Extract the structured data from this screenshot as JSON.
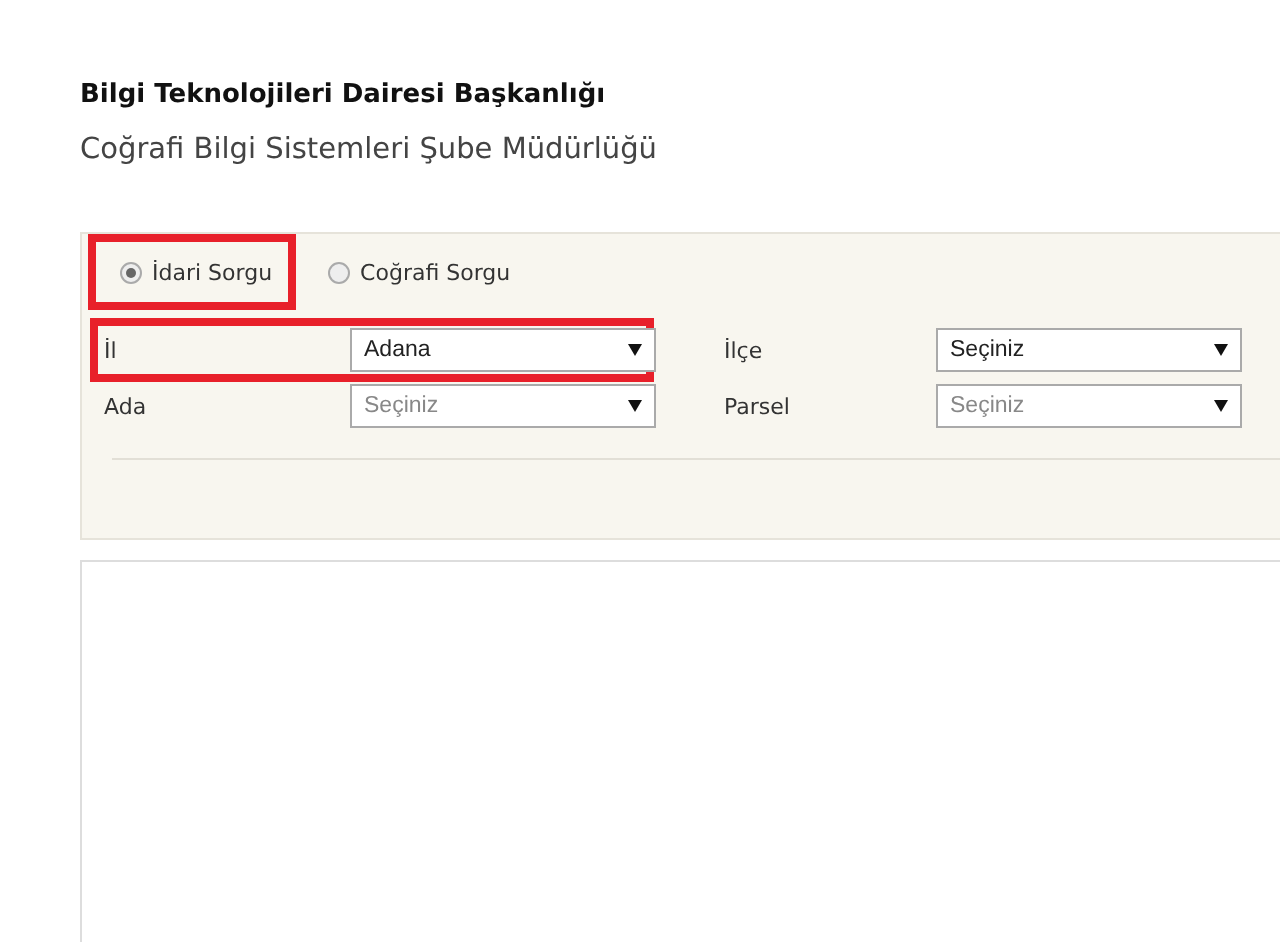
{
  "header": {
    "title": "Bilgi Teknolojileri Dairesi Başkanlığı",
    "subtitle": "Coğrafi Bilgi Sistemleri Şube Müdürlüğü"
  },
  "query_types": [
    {
      "label": "İdari Sorgu",
      "selected": true,
      "highlighted": true
    },
    {
      "label": "Coğrafi Sorgu",
      "selected": false,
      "highlighted": false
    }
  ],
  "fields": [
    {
      "label": "İl",
      "value": "Adana",
      "disabled": false,
      "highlighted": true
    },
    {
      "label": "İlçe",
      "value": "Seçiniz",
      "disabled": false,
      "highlighted": false
    },
    {
      "label": "Ada",
      "value": "Seçiniz",
      "disabled": true,
      "highlighted": false
    },
    {
      "label": "Parsel",
      "value": "Seçiniz",
      "disabled": true,
      "highlighted": false
    }
  ]
}
